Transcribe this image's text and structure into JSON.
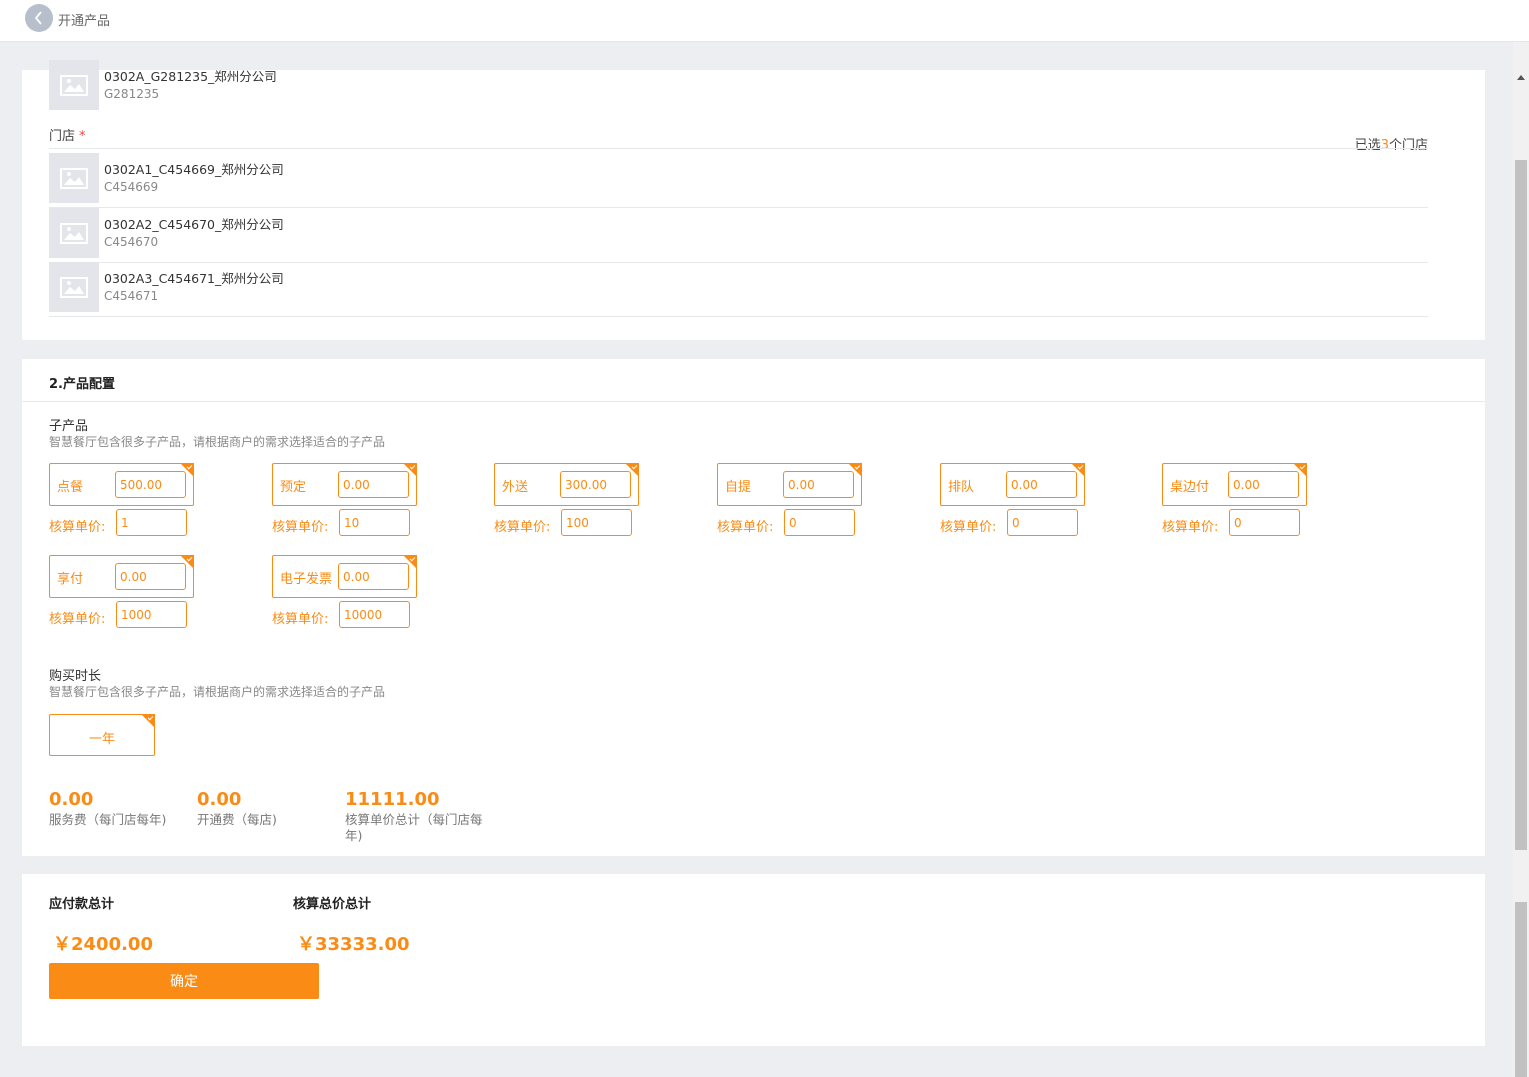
{
  "topbar": {
    "title": "开通产品"
  },
  "stores": {
    "merchant": {
      "name": "0302A_G281235_郑州分公司",
      "code": "G281235"
    },
    "label": "门店",
    "required_mark": "*",
    "selected_prefix": "已选",
    "selected_count": "3",
    "selected_suffix": "个门店",
    "items": [
      {
        "name": "0302A1_C454669_郑州分公司",
        "code": "C454669"
      },
      {
        "name": "0302A2_C454670_郑州分公司",
        "code": "C454670"
      },
      {
        "name": "0302A3_C454671_郑州分公司",
        "code": "C454671"
      }
    ]
  },
  "config": {
    "title": "2.产品配置",
    "sub_products_label": "子产品",
    "sub_products_hint": "智慧餐厅包含很多子产品，请根据商户的需求选择适合的子产品",
    "price_label": "核算单价:",
    "products": [
      {
        "name": "点餐",
        "amount": "500.00",
        "unit_price": "1"
      },
      {
        "name": "预定",
        "amount": "0.00",
        "unit_price": "10"
      },
      {
        "name": "外送",
        "amount": "300.00",
        "unit_price": "100"
      },
      {
        "name": "自提",
        "amount": "0.00",
        "unit_price": "0"
      },
      {
        "name": "排队",
        "amount": "0.00",
        "unit_price": "0"
      },
      {
        "name": "桌边付",
        "amount": "0.00",
        "unit_price": "0"
      },
      {
        "name": "享付",
        "amount": "0.00",
        "unit_price": "1000"
      },
      {
        "name": "电子发票",
        "amount": "0.00",
        "unit_price": "10000"
      }
    ],
    "duration_label": "购买时长",
    "duration_hint": "智慧餐厅包含很多子产品，请根据商户的需求选择适合的子产品",
    "duration_option": "一年",
    "fees": [
      {
        "value": "0.00",
        "label": "服务费（每门店每年)"
      },
      {
        "value": "0.00",
        "label": "开通费（每店)"
      },
      {
        "value": "11111.00",
        "label": "核算单价总计（每门店每年)"
      }
    ]
  },
  "totals": {
    "payable_title": "应付款总计",
    "payable_value": "￥2400.00",
    "accounting_title": "核算总价总计",
    "accounting_value": "￥33333.00",
    "confirm_label": "确定"
  },
  "colors": {
    "accent": "#fa8c16",
    "background": "#eceef1",
    "thumb": "#e3e5ea"
  },
  "icons": {
    "back": "chevron-left-icon",
    "thumb": "image-placeholder-icon"
  }
}
